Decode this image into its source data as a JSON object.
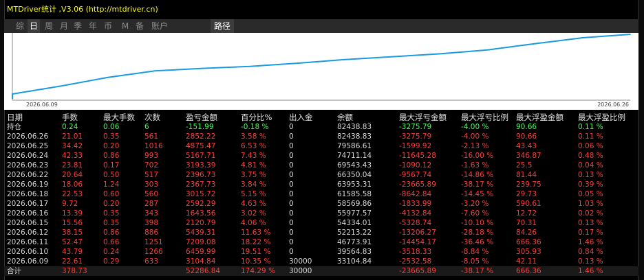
{
  "window": {
    "title": "MTDriver统计 ,V3.06 (http://mtdriver.cn)"
  },
  "tabs": [
    {
      "label": "综",
      "active": false
    },
    {
      "label": "日",
      "active": true
    },
    {
      "label": "周",
      "active": false
    },
    {
      "label": "月",
      "active": false
    },
    {
      "label": "季",
      "active": false
    },
    {
      "label": "年",
      "active": false
    },
    {
      "label": "币",
      "active": false
    },
    {
      "label": "M",
      "active": false
    },
    {
      "label": "备",
      "active": false
    },
    {
      "label": "账户",
      "active": false
    },
    {
      "label": "路径",
      "active": true
    }
  ],
  "chart_data": {
    "type": "line",
    "x": [
      "2026.06.09",
      "2026.06.10",
      "2026.06.11",
      "2026.06.12",
      "2026.06.15",
      "2026.06.16",
      "2026.06.17",
      "2026.06.18",
      "2026.06.19",
      "2026.06.22",
      "2026.06.23",
      "2026.06.24",
      "2026.06.25",
      "2026.06.26"
    ],
    "y": [
      33104.84,
      39564.83,
      46773.91,
      52213.22,
      54334.01,
      55977.57,
      58569.86,
      61585.58,
      63953.31,
      66350.04,
      69543.43,
      74711.14,
      79586.61,
      82438.83
    ],
    "start_label": "2026.06.09",
    "end_label": "2026.06.26",
    "line_color": "#1a9ae0",
    "background": "#ffffff"
  },
  "table": {
    "headers": [
      "日期",
      "手数",
      "最大手数",
      "次数",
      "盈亏金额",
      "百分比%",
      "出入金",
      "余额",
      "最大浮亏金额",
      "最大浮亏比例",
      "最大浮盈金额",
      "最大浮盈比例"
    ],
    "rows": [
      {
        "cells": [
          "持仓",
          "0.24",
          "0.06",
          "6",
          "-151.99",
          "-0.18 %",
          "0",
          "82438.83",
          "-3275.79",
          "-4.00 %",
          "90.66",
          "0.11 %"
        ],
        "color": "green"
      },
      {
        "cells": [
          "2026.06.26",
          "21.01",
          "0.35",
          "561",
          "2852.22",
          "3.58 %",
          "0",
          "82438.83",
          "-3275.79",
          "-4.00 %",
          "90.66",
          "0.11 %"
        ],
        "color": "red"
      },
      {
        "cells": [
          "2026.06.25",
          "34.42",
          "0.20",
          "1016",
          "4875.47",
          "6.53 %",
          "0",
          "79586.61",
          "-1599.92",
          "-2.13 %",
          "43.43",
          "0.06 %"
        ],
        "color": "red"
      },
      {
        "cells": [
          "2026.06.24",
          "42.33",
          "0.86",
          "993",
          "5167.71",
          "7.43 %",
          "0",
          "74711.14",
          "-11645.28",
          "-16.00 %",
          "346.87",
          "0.48 %"
        ],
        "color": "red"
      },
      {
        "cells": [
          "2026.06.23",
          "23.81",
          "0.17",
          "702",
          "3193.39",
          "4.81 %",
          "0",
          "69543.43",
          "-1090.12",
          "-1.63 %",
          "25.5",
          "0.04 %"
        ],
        "color": "red"
      },
      {
        "cells": [
          "2026.06.22",
          "20.64",
          "0.50",
          "517",
          "2396.73",
          "3.75 %",
          "0",
          "66350.04",
          "-9567.74",
          "-14.86 %",
          "81.44",
          "0.13 %"
        ],
        "color": "red"
      },
      {
        "cells": [
          "2026.06.19",
          "18.06",
          "1.24",
          "303",
          "2367.73",
          "3.84 %",
          "0",
          "63953.31",
          "-23665.89",
          "-38.17 %",
          "239.75",
          "0.39 %"
        ],
        "color": "red"
      },
      {
        "cells": [
          "2026.06.18",
          "22.53",
          "0.60",
          "560",
          "3015.72",
          "5.15 %",
          "0",
          "61585.58",
          "-8642.84",
          "-14.45 %",
          "29.73",
          "0.05 %"
        ],
        "color": "red"
      },
      {
        "cells": [
          "2026.06.17",
          "9.72",
          "0.20",
          "287",
          "2592.29",
          "4.63 %",
          "0",
          "58569.86",
          "-1833.99",
          "-3.20 %",
          "590.61",
          "1.03 %"
        ],
        "color": "red"
      },
      {
        "cells": [
          "2026.06.16",
          "13.39",
          "0.35",
          "343",
          "1643.56",
          "3.02 %",
          "0",
          "55977.57",
          "-4132.84",
          "-7.60 %",
          "12.72",
          "0.02 %"
        ],
        "color": "red"
      },
      {
        "cells": [
          "2026.06.15",
          "15.56",
          "0.35",
          "398",
          "2120.79",
          "4.06 %",
          "0",
          "54334.01",
          "-5328.74",
          "-10.10 %",
          "70.31",
          "0.13 %"
        ],
        "color": "red"
      },
      {
        "cells": [
          "2026.06.12",
          "38.15",
          "0.86",
          "886",
          "5439.31",
          "11.63 %",
          "0",
          "52213.22",
          "-13206.27",
          "-28.18 %",
          "84.26",
          "0.17 %"
        ],
        "color": "red"
      },
      {
        "cells": [
          "2026.06.11",
          "52.47",
          "0.66",
          "1251",
          "7209.08",
          "18.22 %",
          "0",
          "46773.91",
          "-14454.17",
          "-36.46 %",
          "666.36",
          "1.46 %"
        ],
        "color": "red"
      },
      {
        "cells": [
          "2026.06.10",
          "43.79",
          "0.24",
          "1266",
          "6459.99",
          "19.51 %",
          "0",
          "39564.83",
          "-3518.33",
          "-8.84 %",
          "305.93",
          "0.84 %"
        ],
        "color": "red"
      },
      {
        "cells": [
          "2026.06.09",
          "22.61",
          "0.29",
          "633",
          "3104.84",
          "10.35 %",
          "30000",
          "33104.84",
          "-2532.58",
          "-8.05 %",
          "42.11",
          "0.13 %"
        ],
        "color": "red"
      },
      {
        "cells": [
          "合计",
          "378.73",
          "",
          "",
          "52286.84",
          "174.29 %",
          "30000",
          "",
          "-23665.89",
          "-38.17 %",
          "666.36",
          "1.46 %"
        ],
        "color": "red",
        "summary": true
      }
    ]
  }
}
